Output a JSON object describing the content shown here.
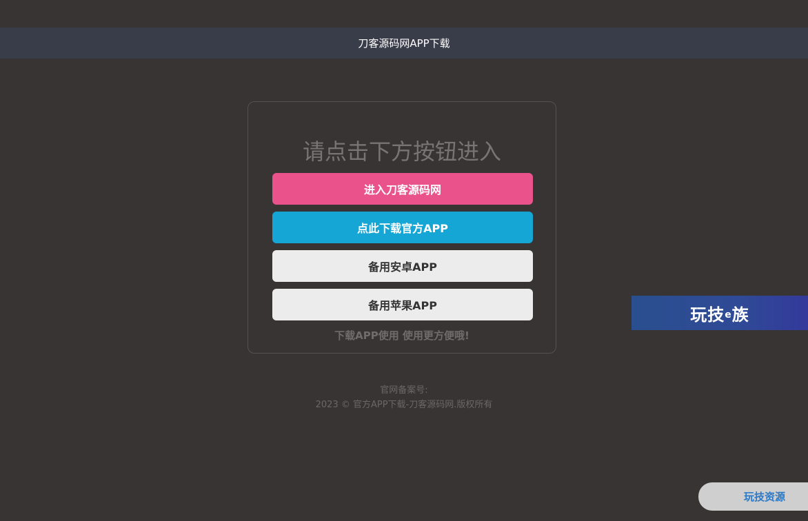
{
  "header": {
    "title": "刀客源码网APP下载"
  },
  "card": {
    "title": "请点击下方按钮进入",
    "buttons": {
      "enter": "进入刀客源码网",
      "download_official": "点此下载官方APP",
      "backup_android": "备用安卓APP",
      "backup_apple": "备用苹果APP"
    },
    "note": "下载APP使用 使用更方便哦!"
  },
  "footer": {
    "icp_label": "官网备案号:",
    "copyright": "2023 © 官方APP下载-刀客源码网.版权所有"
  },
  "side_banner": {
    "text_part1": "玩技",
    "text_small": "e",
    "text_part2": "族"
  },
  "corner_badge": {
    "label": "玩技资源"
  },
  "colors": {
    "background": "#383433",
    "topbar": "#393c49",
    "button_pink": "#e9528a",
    "button_blue": "#16a6d5",
    "button_gray": "#ececec",
    "banner_blue": "#2f4a96",
    "badge_text": "#2a79c8"
  }
}
